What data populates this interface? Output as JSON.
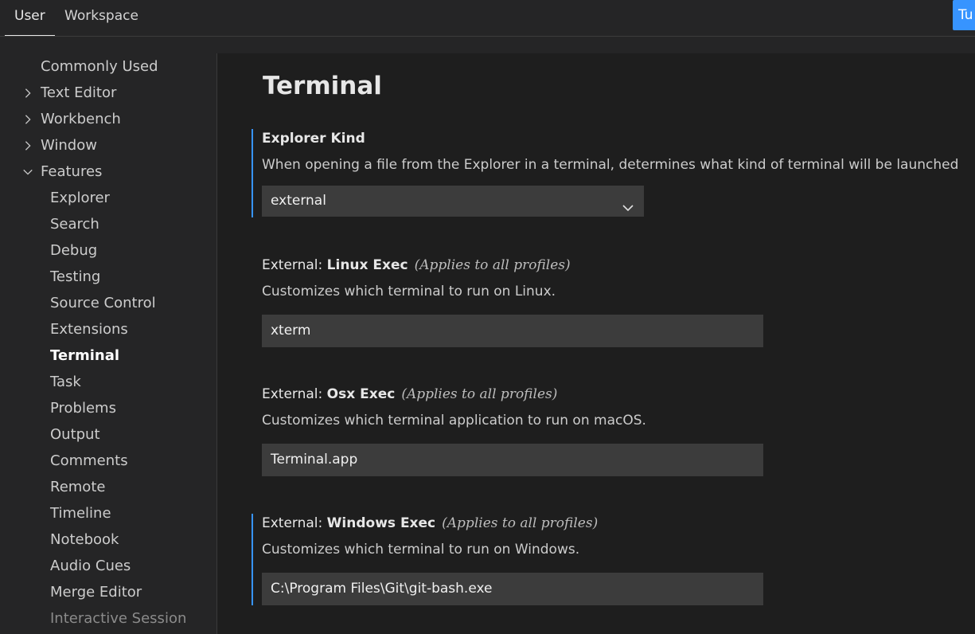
{
  "tabs": {
    "user": "User",
    "workspace": "Workspace",
    "turn_button": "Tu"
  },
  "sidebar": {
    "items": [
      {
        "label": "Commonly Used",
        "level": "top",
        "chevron": "none"
      },
      {
        "label": "Text Editor",
        "level": "top",
        "chevron": "right"
      },
      {
        "label": "Workbench",
        "level": "top",
        "chevron": "right"
      },
      {
        "label": "Window",
        "level": "top",
        "chevron": "right"
      },
      {
        "label": "Features",
        "level": "top",
        "chevron": "down"
      },
      {
        "label": "Explorer",
        "level": "sub"
      },
      {
        "label": "Search",
        "level": "sub"
      },
      {
        "label": "Debug",
        "level": "sub"
      },
      {
        "label": "Testing",
        "level": "sub"
      },
      {
        "label": "Source Control",
        "level": "sub"
      },
      {
        "label": "Extensions",
        "level": "sub"
      },
      {
        "label": "Terminal",
        "level": "sub",
        "active": true
      },
      {
        "label": "Task",
        "level": "sub"
      },
      {
        "label": "Problems",
        "level": "sub"
      },
      {
        "label": "Output",
        "level": "sub"
      },
      {
        "label": "Comments",
        "level": "sub"
      },
      {
        "label": "Remote",
        "level": "sub"
      },
      {
        "label": "Timeline",
        "level": "sub"
      },
      {
        "label": "Notebook",
        "level": "sub"
      },
      {
        "label": "Audio Cues",
        "level": "sub"
      },
      {
        "label": "Merge Editor",
        "level": "sub"
      },
      {
        "label": "Interactive Session",
        "level": "sub",
        "dim": true
      }
    ]
  },
  "main": {
    "title": "Terminal",
    "settings": {
      "explorer_kind": {
        "key": "Explorer Kind",
        "description": "When opening a file from the Explorer in a terminal, determines what kind of terminal will be launched",
        "value": "external"
      },
      "linux_exec": {
        "category": "External: ",
        "key": "Linux Exec",
        "scope": "(Applies to all profiles)",
        "description": "Customizes which terminal to run on Linux.",
        "value": "xterm"
      },
      "osx_exec": {
        "category": "External: ",
        "key": "Osx Exec",
        "scope": "(Applies to all profiles)",
        "description": "Customizes which terminal application to run on macOS.",
        "value": "Terminal.app"
      },
      "windows_exec": {
        "category": "External: ",
        "key": "Windows Exec",
        "scope": "(Applies to all profiles)",
        "description": "Customizes which terminal to run on Windows.",
        "value": "C:\\Program Files\\Git\\git-bash.exe"
      }
    }
  },
  "colors": {
    "accent": "#3794ff",
    "input_bg": "#3c3c3c",
    "editor_bg": "#1e1e1e",
    "sidebar_bg": "#252526"
  }
}
